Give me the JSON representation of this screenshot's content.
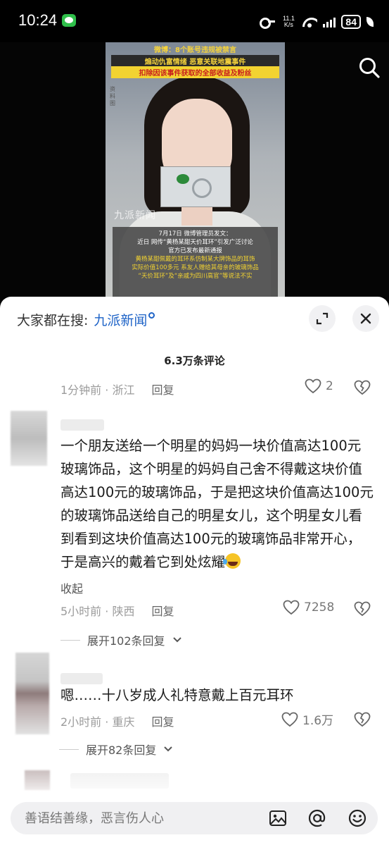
{
  "status_bar": {
    "time": "10:24",
    "net_speed_value": "11.1",
    "net_speed_unit": "K/s",
    "battery": "84"
  },
  "video": {
    "banner_line1": "微博：8个账号违规被禁言",
    "banner_line2": "煽动仇富情绪 恶意关联地震事件",
    "banner_line3": "扣除因该事件获取的全部收益及粉丝",
    "side_text": "资料图",
    "logo_text": "九派新闻",
    "caption_lines": [
      "7月17日 微博管理员发文：",
      "近日 网传“黄杨某甜天价耳环”引发广泛讨论",
      "官方已发布最新通报",
      "黄杨某甜佩戴的耳环系仿制某大牌饰品的耳饰",
      "实际价值100多元 系友人赠给其母亲的玻璃饰品",
      "“天价耳环”及“亲戚为四川高官”等说法不实"
    ]
  },
  "sheet": {
    "search_prefix": "大家都在搜:",
    "search_keyword": "九派新闻",
    "comment_count": "6.3万条评论"
  },
  "comments": [
    {
      "time": "1分钟前",
      "location": "浙江",
      "reply_label": "回复",
      "likes": "2"
    },
    {
      "text": "一个朋友送给一个明星的妈妈一块价值高达100元玻璃饰品，这个明星的妈妈自己舍不得戴这块价值高达100元的玻璃饰品，于是把这块价值高达100元的玻璃饰品送给自己的明星女儿，这个明星女儿看到看到这块价值高达100元的玻璃饰品非常开心，于是高兴的戴着它到处炫耀",
      "collapse_label": "收起",
      "time": "5小时前",
      "location": "陕西",
      "reply_label": "回复",
      "likes": "7258",
      "expand_label": "展开102条回复"
    },
    {
      "text": "嗯……十八岁成人礼特意戴上百元耳环",
      "time": "2小时前",
      "location": "重庆",
      "reply_label": "回复",
      "likes": "1.6万",
      "expand_label": "展开82条回复"
    }
  ],
  "input_bar": {
    "placeholder": "善语结善缘，恶言伤人心"
  },
  "icons": {
    "search": "search-icon",
    "expand": "expand-icon",
    "close": "close-icon",
    "like": "heart-icon",
    "dislike": "broken-heart-icon",
    "image": "image-icon",
    "mention": "at-icon",
    "emoji": "smiley-icon"
  },
  "colors": {
    "accent_link": "#1e63c7",
    "meta_gray": "#9b9b9b",
    "input_bg": "#f0f0f2"
  }
}
